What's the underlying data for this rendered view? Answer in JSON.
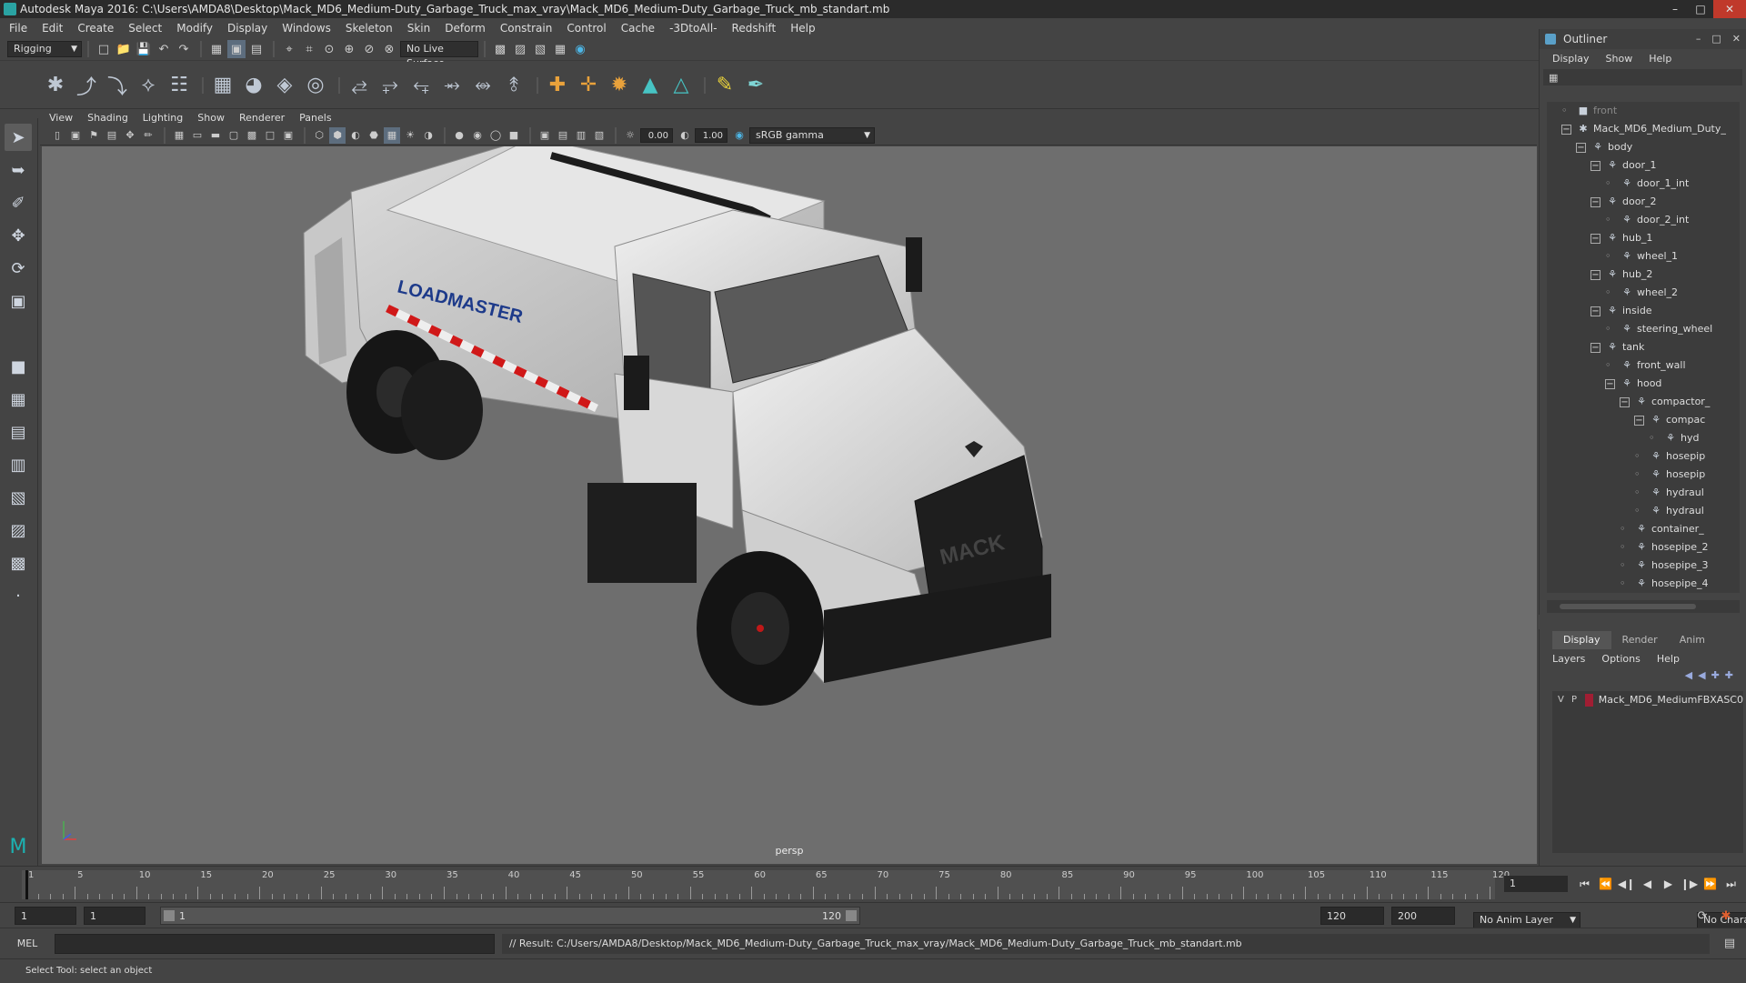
{
  "window": {
    "title": "Autodesk Maya 2016: C:\\Users\\AMDA8\\Desktop\\Mack_MD6_Medium-Duty_Garbage_Truck_max_vray\\Mack_MD6_Medium-Duty_Garbage_Truck_mb_standart.mb",
    "buttons": [
      "minimize",
      "maximize",
      "close"
    ]
  },
  "menubar": [
    "File",
    "Edit",
    "Create",
    "Select",
    "Modify",
    "Display",
    "Windows",
    "Skeleton",
    "Skin",
    "Deform",
    "Constrain",
    "Control",
    "Cache",
    "-3DtoAll-",
    "Redshift",
    "Help"
  ],
  "statusline": {
    "menu_set": "Rigging",
    "live_surface": "No Live Surface"
  },
  "panel": {
    "menus": [
      "View",
      "Shading",
      "Lighting",
      "Show",
      "Renderer",
      "Panels"
    ],
    "exposure": "0.00",
    "gamma": "1.00",
    "color_space": "sRGB gamma",
    "camera_label": "persp"
  },
  "viewport": {
    "model_text": "LOADMASTER",
    "grille_text": "MACK"
  },
  "outliner": {
    "title": "Outliner",
    "menus": [
      "Display",
      "Show",
      "Help"
    ],
    "items": [
      {
        "label": "front",
        "indent": 0,
        "dim": true
      },
      {
        "label": "Mack_MD6_Medium_Duty_",
        "indent": 0,
        "expand": true
      },
      {
        "label": "body",
        "indent": 1,
        "expand": true
      },
      {
        "label": "door_1",
        "indent": 2,
        "expand": true
      },
      {
        "label": "door_1_int",
        "indent": 3
      },
      {
        "label": "door_2",
        "indent": 2,
        "expand": true
      },
      {
        "label": "door_2_int",
        "indent": 3
      },
      {
        "label": "hub_1",
        "indent": 2,
        "expand": true
      },
      {
        "label": "wheel_1",
        "indent": 3
      },
      {
        "label": "hub_2",
        "indent": 2,
        "expand": true
      },
      {
        "label": "wheel_2",
        "indent": 3
      },
      {
        "label": "inside",
        "indent": 2,
        "expand": true
      },
      {
        "label": "steering_wheel",
        "indent": 3
      },
      {
        "label": "tank",
        "indent": 2,
        "expand": true
      },
      {
        "label": "front_wall",
        "indent": 3
      },
      {
        "label": "hood",
        "indent": 3,
        "expand": true
      },
      {
        "label": "compactor_",
        "indent": 4,
        "expand": true
      },
      {
        "label": "compac",
        "indent": 5,
        "expand": true
      },
      {
        "label": "hyd",
        "indent": 6
      },
      {
        "label": "hosepip",
        "indent": 5
      },
      {
        "label": "hosepip",
        "indent": 5
      },
      {
        "label": "hydraul",
        "indent": 5
      },
      {
        "label": "hydraul",
        "indent": 5
      },
      {
        "label": "container_",
        "indent": 4
      },
      {
        "label": "hosepipe_2",
        "indent": 4
      },
      {
        "label": "hosepipe_3",
        "indent": 4
      },
      {
        "label": "hosepipe_4",
        "indent": 4
      }
    ]
  },
  "layers": {
    "tabs": [
      "Display",
      "Render",
      "Anim"
    ],
    "active_tab": "Display",
    "menus": [
      "Layers",
      "Options",
      "Help"
    ],
    "rows": [
      {
        "v": "V",
        "p": "P",
        "color": "#a01e33",
        "name": "Mack_MD6_MediumFBXASC0"
      }
    ]
  },
  "timeline": {
    "ticks": [
      1,
      5,
      10,
      15,
      20,
      25,
      30,
      35,
      40,
      45,
      50,
      55,
      60,
      65,
      70,
      75,
      80,
      85,
      90,
      95,
      100,
      105,
      110,
      115,
      120
    ],
    "start": 1,
    "end": 120,
    "current_frame": "1"
  },
  "range": {
    "start_field": "1",
    "start_field2": "1",
    "slider_start": "1",
    "slider_end": "120",
    "end_field": "120",
    "end_field2": "200",
    "anim_layer": "No Anim Layer",
    "character_set": "No Character Set"
  },
  "command": {
    "label": "MEL",
    "result": "// Result: C:/Users/AMDA8/Desktop/Mack_MD6_Medium-Duty_Garbage_Truck_max_vray/Mack_MD6_Medium-Duty_Garbage_Truck_mb_standart.mb"
  },
  "helpline": "Select Tool: select an object"
}
